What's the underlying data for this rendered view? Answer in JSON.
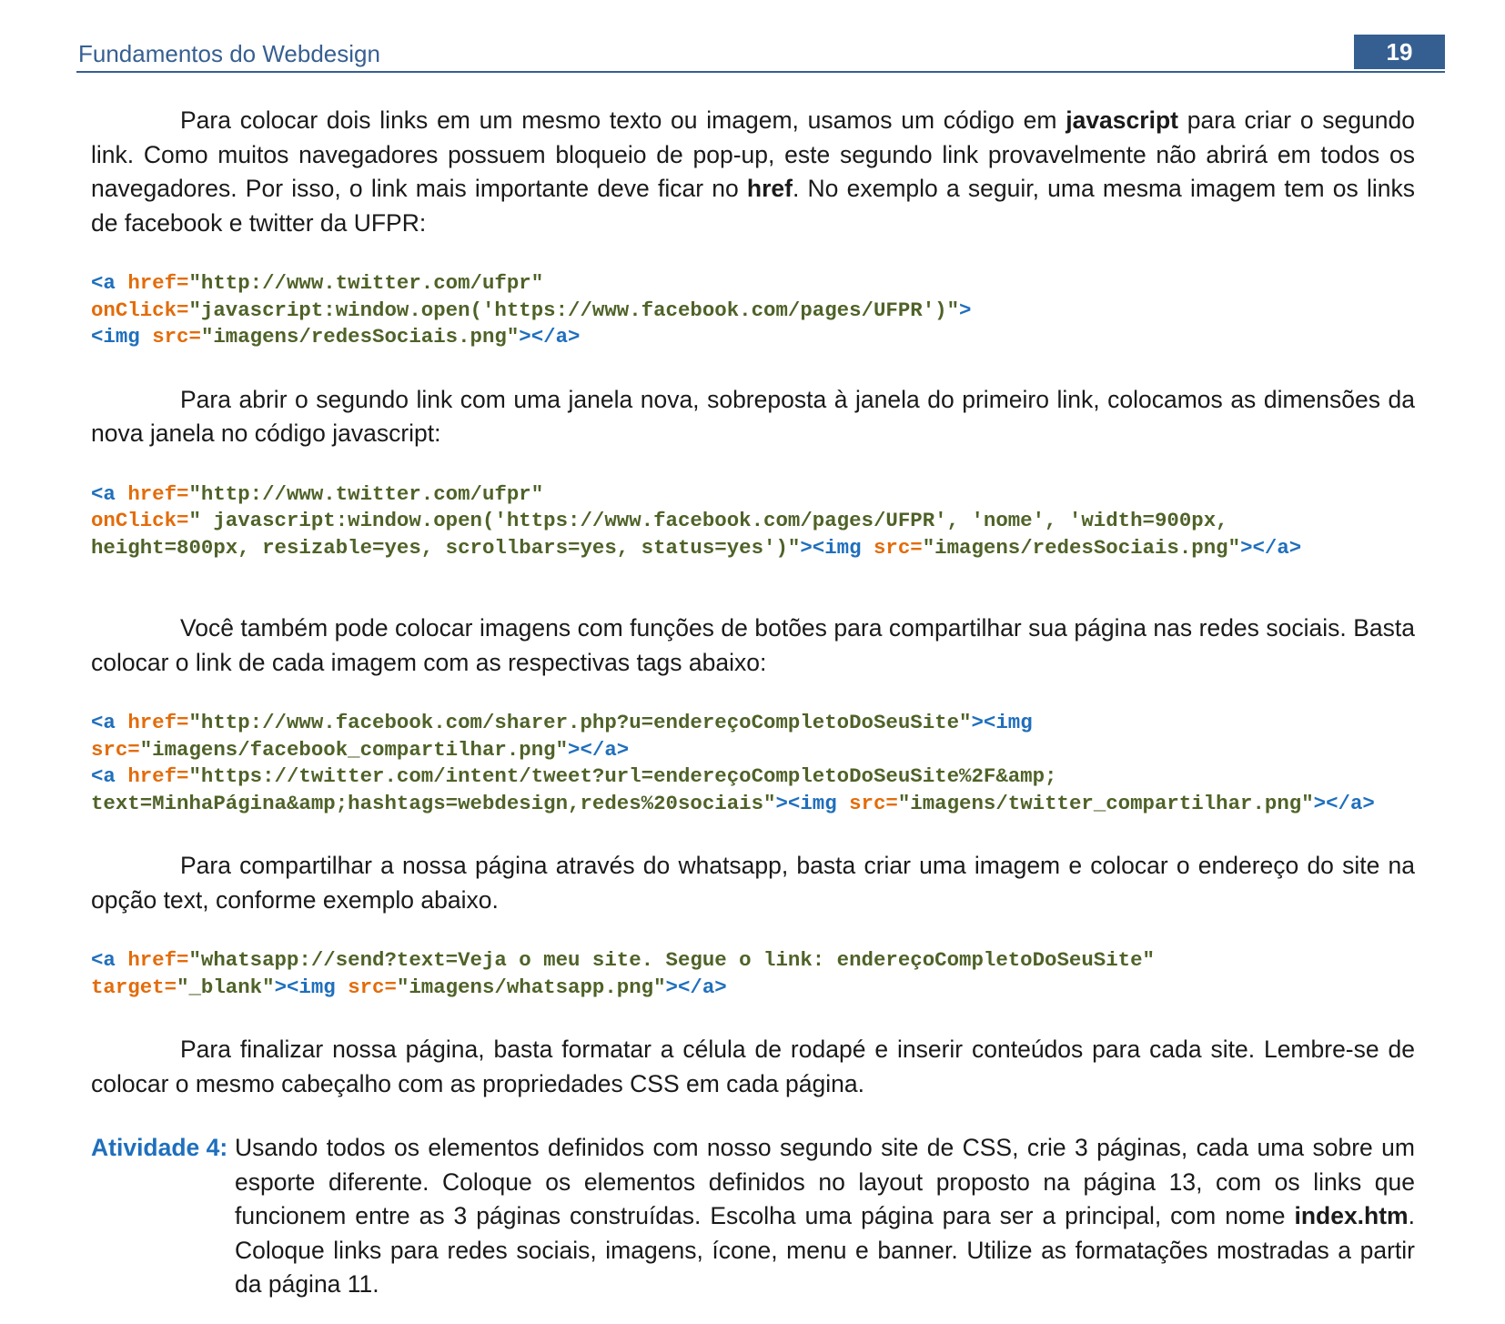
{
  "header": {
    "title": "Fundamentos do Webdesign",
    "page_number": "19"
  },
  "p1": {
    "s1": "Para colocar dois links em um mesmo texto ou imagem, usamos um código em ",
    "b1": "javascript",
    "s2": " para criar o segundo link. Como muitos navegadores possuem bloqueio de pop-up, este segundo link provavelmente não abrirá em todos os navegadores. Por isso, o link mais importante deve ficar no ",
    "b2": "href",
    "s3": ". No exemplo a seguir, uma mesma imagem tem os links de facebook e twitter da UFPR:"
  },
  "code1": {
    "l1": [
      "<a ",
      "href=",
      "\"http://www.twitter.com/ufpr\""
    ],
    "l2": [
      "onClick=",
      "\"javascript:window.open('https://www.facebook.com/pages/UFPR')\"",
      ">"
    ],
    "l3": [
      "<img ",
      "src=",
      "\"imagens/redesSociais.png\"",
      "></a>"
    ]
  },
  "p2": "Para abrir o segundo link com uma janela nova, sobreposta à janela do primeiro link, colocamos as dimensões da nova janela no código javascript:",
  "code2": {
    "l1": [
      "<a ",
      "href=",
      "\"http://www.twitter.com/ufpr\""
    ],
    "l2": [
      "onClick=",
      "\" javascript:window.open('https://www.facebook.com/pages/UFPR', 'nome', 'width=900px,"
    ],
    "l3": [
      "height=800px, resizable=yes, scrollbars=yes, status=yes')\"",
      "><img ",
      "src=",
      "\"imagens/redesSociais.png\"",
      "></a>"
    ]
  },
  "p3": "Você também pode colocar imagens com funções de botões para compartilhar sua página nas redes sociais. Basta colocar o link de cada imagem com as respectivas tags abaixo:",
  "code3": {
    "l1": [
      "<a ",
      "href=",
      "\"http://www.facebook.com/sharer.php?u=endereçoCompletoDoSeuSite\"",
      "><img"
    ],
    "l2": [
      "src=",
      "\"imagens/facebook_compartilhar.png\"",
      "></a>"
    ],
    "l3": [
      "<a ",
      "href=",
      "\"https://twitter.com/intent/tweet?url=endereçoCompletoDoSeuSite%2F&amp;"
    ],
    "l4": [
      "text=MinhaPágina&amp;hashtags=webdesign,redes%20sociais\"",
      "><img ",
      "src=",
      "\"imagens/twitter_compartilhar.png\"",
      "></a>"
    ]
  },
  "p4": "Para compartilhar a nossa página através do whatsapp, basta criar uma imagem e colocar o endereço do site na opção text, conforme exemplo abaixo.",
  "code4": {
    "l1": [
      "<a ",
      "href=",
      "\"whatsapp://send?text=Veja o meu site. Segue o link: endereçoCompletoDoSeuSite\""
    ],
    "l2": [
      "target=",
      "\"_blank\"",
      "><img ",
      "src=",
      "\"imagens/whatsapp.png\"",
      "></a>"
    ]
  },
  "p5": "Para finalizar nossa página, basta formatar a célula de rodapé e inserir conteúdos para cada site. Lembre-se de colocar o mesmo cabeçalho com as propriedades CSS em cada página.",
  "activity": {
    "label": "Atividade 4:",
    "s1": "Usando todos os elementos definidos com nosso segundo site de CSS, crie 3 páginas, cada uma sobre um esporte diferente. Coloque os elementos definidos no layout proposto na página 13, com os links que funcionem entre as 3 páginas construídas. Escolha uma página para ser a principal, com nome ",
    "b1": "index.htm",
    "s2": ". Coloque links para redes sociais, imagens, ícone, menu e banner. Utilize as formatações mostradas a partir da página 11."
  }
}
